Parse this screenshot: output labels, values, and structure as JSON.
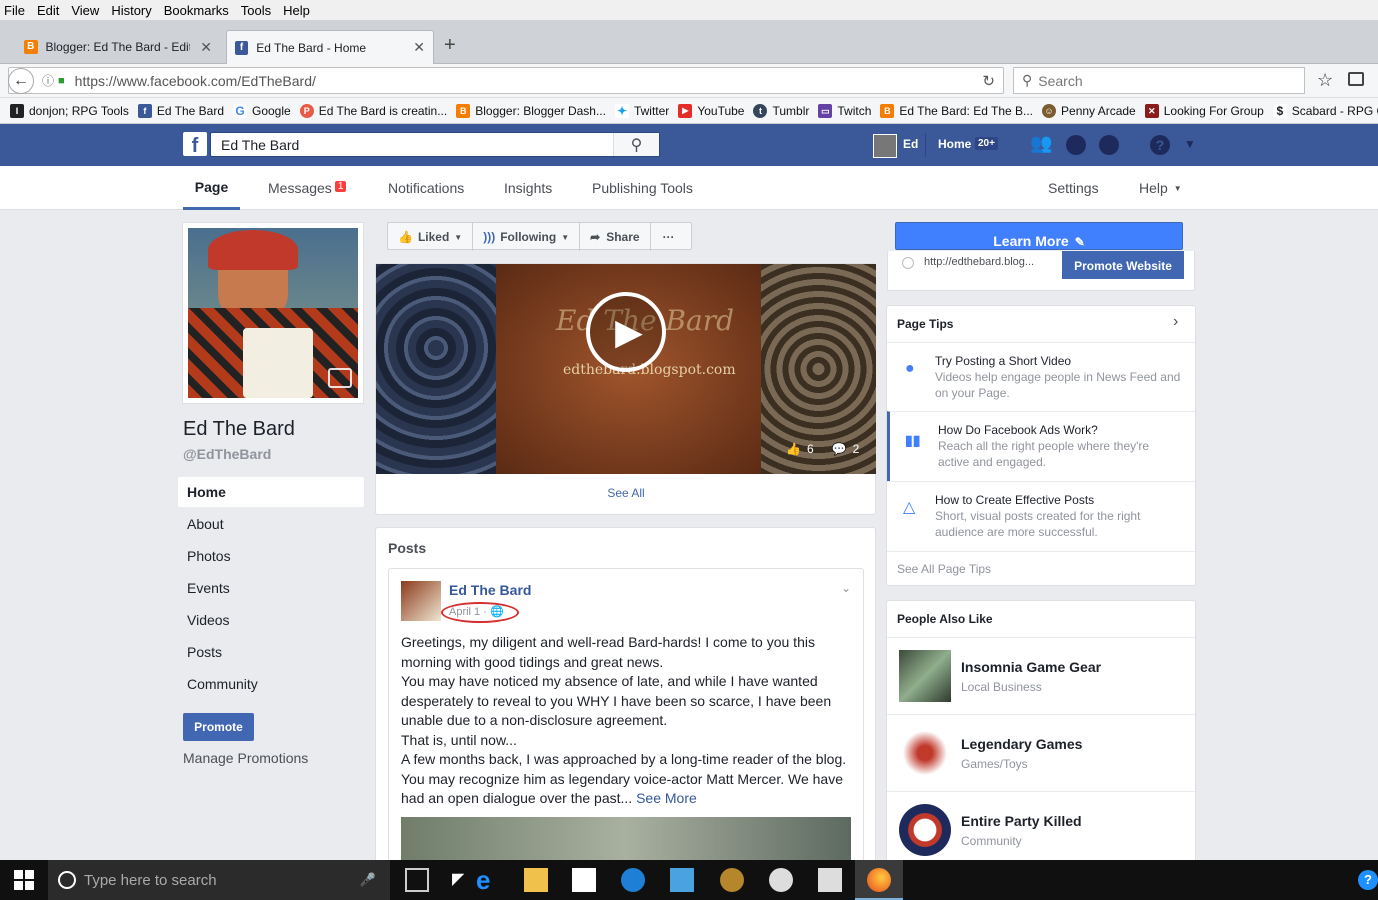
{
  "browser": {
    "menu": [
      "File",
      "Edit",
      "View",
      "History",
      "Bookmarks",
      "Tools",
      "Help"
    ],
    "tabs": [
      {
        "title": "Blogger: Ed The Bard - Edit p"
      },
      {
        "title": "Ed The Bard - Home"
      }
    ],
    "url": "https://www.facebook.com/EdTheBard/",
    "search_placeholder": "Search",
    "bookmarks": [
      "donjon; RPG Tools",
      "Ed The Bard",
      "Google",
      "Ed The Bard is creatin...",
      "Blogger: Blogger Dash...",
      "Twitter",
      "YouTube",
      "Tumblr",
      "Twitch",
      "Ed The Bard: Ed The B...",
      "Penny Arcade",
      "Looking For Group",
      "Scabard - RPG Ca"
    ]
  },
  "fb": {
    "search_value": "Ed The Bard",
    "user": "Ed",
    "home": "Home",
    "home_badge": "20+"
  },
  "pagenav": {
    "items": [
      "Page",
      "Messages",
      "Notifications",
      "Insights",
      "Publishing Tools"
    ],
    "messages_badge": "1",
    "settings": "Settings",
    "help": "Help"
  },
  "left": {
    "page_name": "Ed The Bard",
    "handle": "@EdTheBard",
    "nav": [
      "Home",
      "About",
      "Photos",
      "Events",
      "Videos",
      "Posts",
      "Community"
    ],
    "promote": "Promote",
    "manage": "Manage Promotions"
  },
  "actions": {
    "liked": "Liked",
    "following": "Following",
    "share": "Share",
    "more": "···",
    "learn_more": "Learn More"
  },
  "video": {
    "title_text": "Ed The Bard",
    "url_text": "edthebard.blogspot.com",
    "likes": "6",
    "comments": "2",
    "see_all": "See All"
  },
  "posts": {
    "header": "Posts",
    "author": "Ed The Bard",
    "date": "April 1 ·",
    "paragraphs": [
      "Greetings, my diligent and well-read Bard-hards! I come to you this morning with good tidings and great news.",
      "You may have noticed my absence of late, and while I have wanted desperately to reveal to you WHY I have been so scarce, I have been unable due to a non-disclosure agreement.",
      "That is, until now...",
      "A few months back, I was approached by a long-time reader of the blog. You may recognize him as legendary voice-actor Matt Mercer. We have had an open dialogue over the past..."
    ],
    "see_more": "See More"
  },
  "right": {
    "partial_link": "http://edthebard.blog...",
    "promote_website": "Promote Website",
    "tips_header": "Page Tips",
    "tips": [
      {
        "title": "Try Posting a Short Video",
        "desc": "Videos help engage people in News Feed and on your Page."
      },
      {
        "title": "How Do Facebook Ads Work?",
        "desc": "Reach all the right people where they're active and engaged."
      },
      {
        "title": "How to Create Effective Posts",
        "desc": "Short, visual posts created for the right audience are more successful."
      }
    ],
    "see_all_tips": "See All Page Tips",
    "people_header": "People Also Like",
    "people": [
      {
        "name": "Insomnia Game Gear",
        "category": "Local Business"
      },
      {
        "name": "Legendary Games",
        "category": "Games/Toys"
      },
      {
        "name": "Entire Party Killed",
        "category": "Community"
      }
    ]
  },
  "taskbar": {
    "search_placeholder": "Type here to search"
  }
}
